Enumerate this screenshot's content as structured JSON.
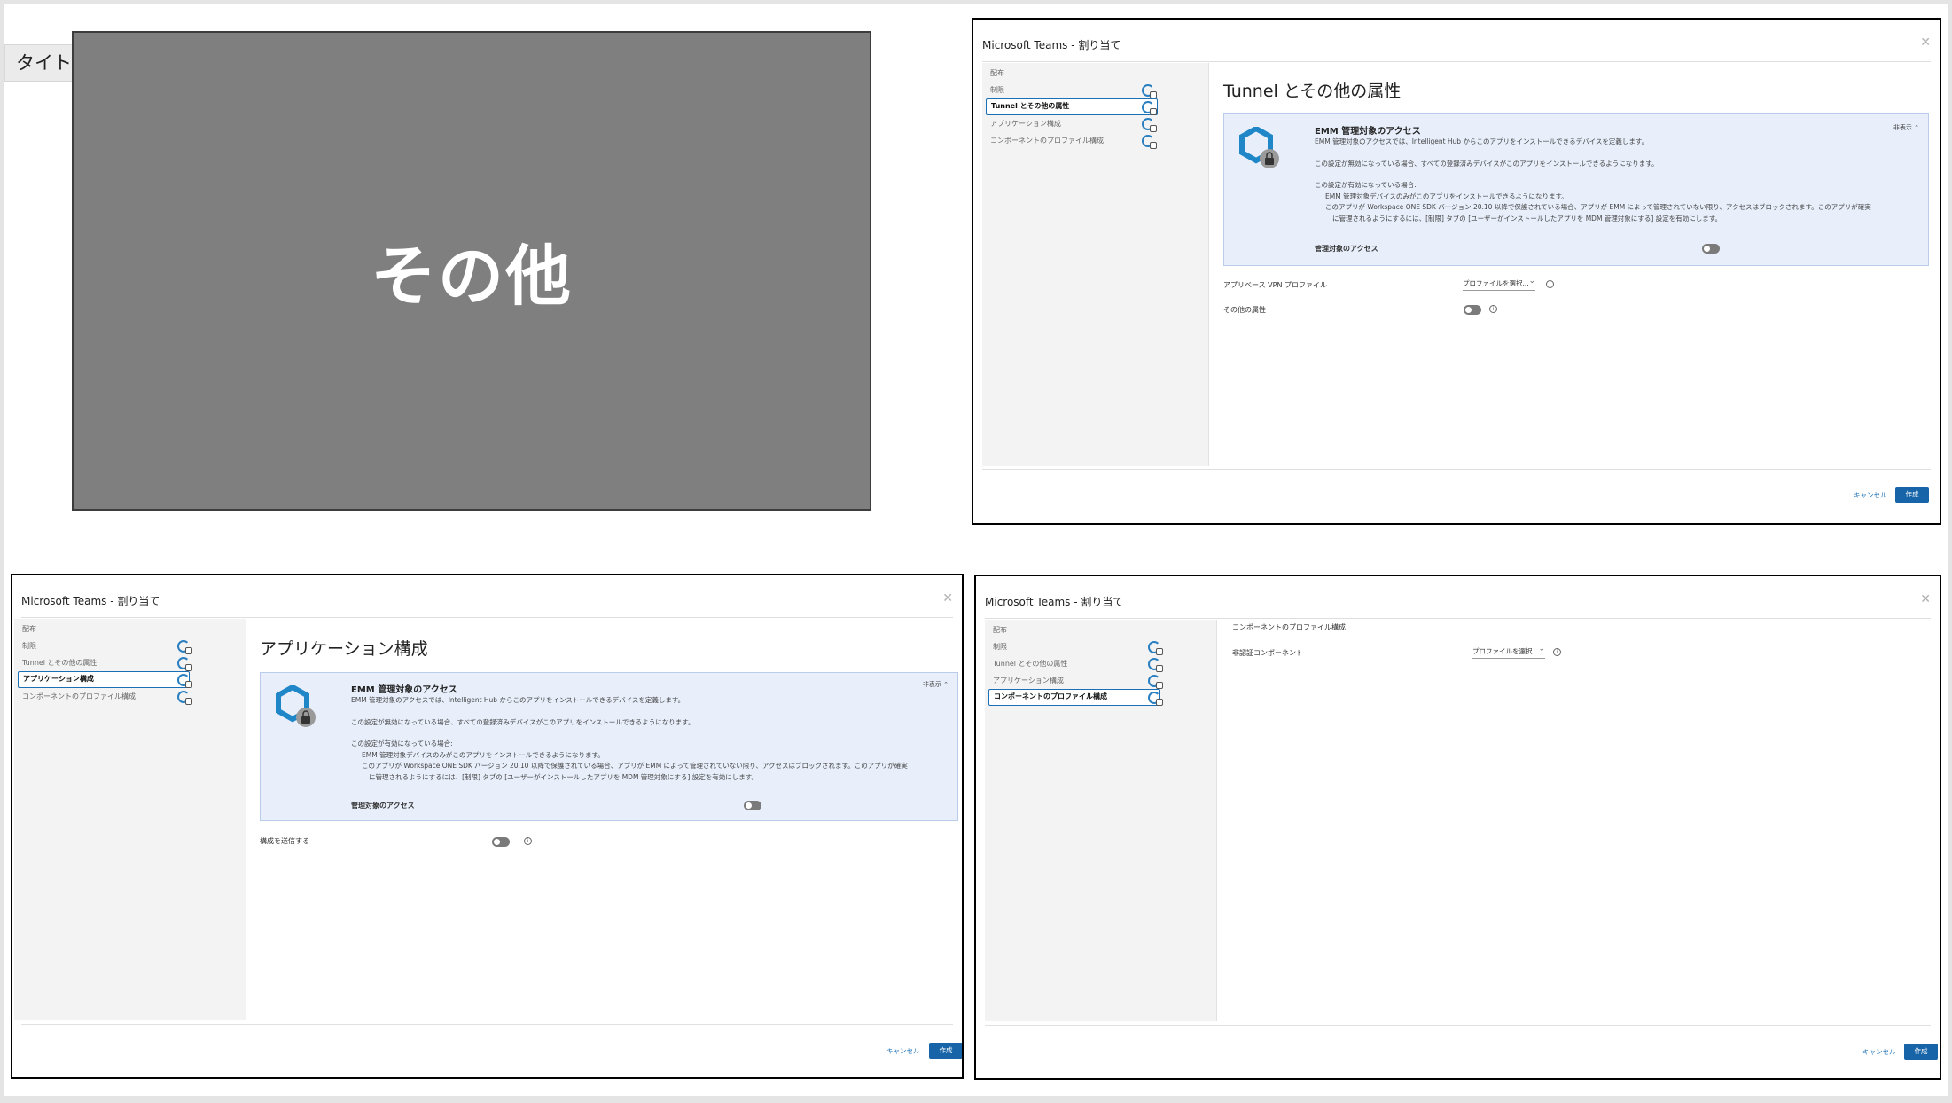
{
  "slide": {
    "title_tag": "タイトルなし]",
    "big_text": "その他"
  },
  "dialog_title": "Microsoft Teams - 割り当て",
  "nav": [
    "配布",
    "制限",
    "Tunnel とその他の属性",
    "アプリケーション構成",
    "コンポーネントのプロファイル構成"
  ],
  "emm": {
    "heading": "EMM 管理対象のアクセス",
    "hide_link": "非表示 ⌃",
    "line1": "EMM 管理対象のアクセスでは、Intelligent Hub からこのアプリをインストールできるデバイスを定義します。",
    "line2": "この設定が無効になっている場合、すべての登録済みデバイスがこのアプリをインストールできるようになります。",
    "line3": "この設定が有効になっている場合:",
    "bullet1": "EMM 管理対象デバイスのみがこのアプリをインストールできるようになります。",
    "bullet2": "このアプリが Workspace ONE SDK バージョン 20.10 以降で保護されている場合、アプリが EMM によって管理されていない限り、アクセスはブロックされます。このアプリが確実",
    "bullet2b": "に管理されるようにするには、[制限] タブの [ユーザーがインストールしたアプリを MDM 管理対象にする] 設定を有効にします。",
    "toggle_label": "管理対象のアクセス"
  },
  "shot1": {
    "title": "Tunnel とその他の属性",
    "vpn_label": "アプリベース VPN プロファイル",
    "vpn_select": "プロファイルを選択...",
    "other_label": "その他の属性"
  },
  "shot2": {
    "title": "アプリケーション構成",
    "config_label": "構成を送信する"
  },
  "shot3": {
    "section": "コンポーネントのプロファイル構成",
    "comp_label": "非認証コンポーネント",
    "comp_select": "プロファイルを選択..."
  },
  "footer": {
    "cancel": "キャンセル",
    "create": "作成"
  }
}
